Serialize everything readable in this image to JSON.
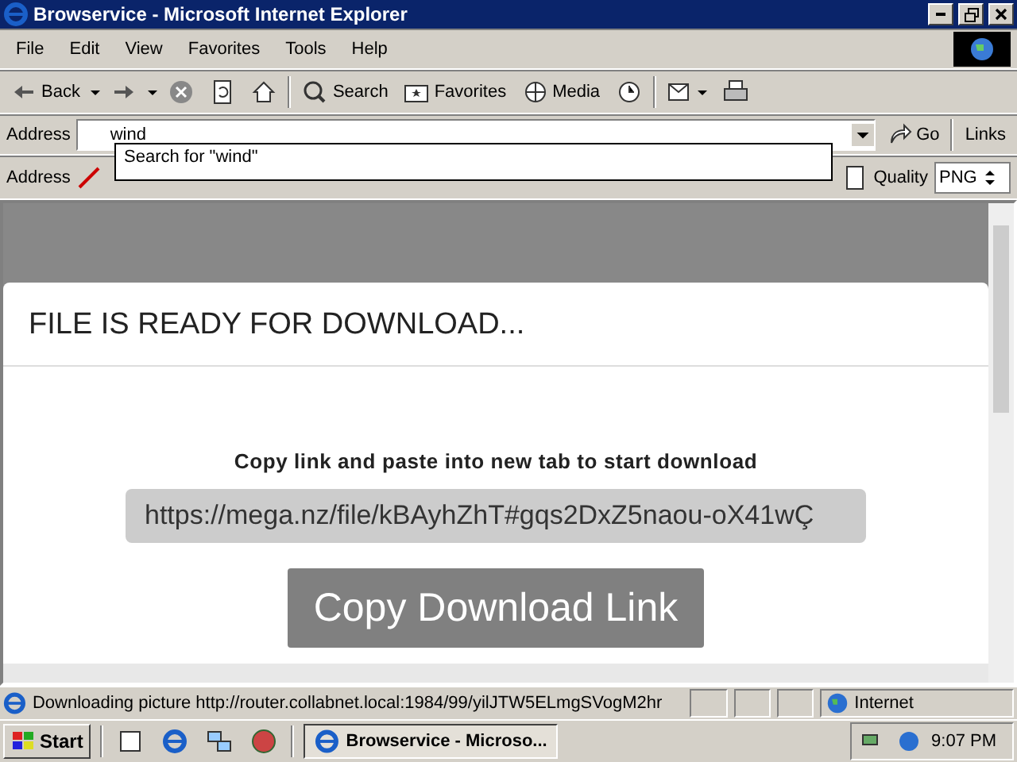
{
  "window": {
    "title": "Browservice - Microsoft Internet Explorer"
  },
  "menu": [
    "File",
    "Edit",
    "View",
    "Favorites",
    "Tools",
    "Help"
  ],
  "toolbar": {
    "back": "Back",
    "search": "Search",
    "favorites": "Favorites",
    "media": "Media"
  },
  "address_bar": {
    "label": "Address",
    "value": "wind",
    "go": "Go",
    "links": "Links",
    "suggestion": "Search for \"wind\""
  },
  "page_toolbar": {
    "label": "Address",
    "quality_label": "Quality",
    "quality": "PNG"
  },
  "page": {
    "heading": "FILE IS READY FOR DOWNLOAD...",
    "instruction": "Copy link and paste into new tab to start download",
    "link": "https://mega.nz/file/kBAyhZhT#gqs2DxZ5naou-oX41wÇ",
    "button": "Copy Download Link"
  },
  "status_bar": {
    "text": "Downloading picture http://router.collabnet.local:1984/99/yilJTW5ELmgSVogM2hr",
    "zone": "Internet"
  },
  "taskbar": {
    "start": "Start",
    "task": "Browservice - Microso...",
    "clock": "9:07 PM"
  }
}
